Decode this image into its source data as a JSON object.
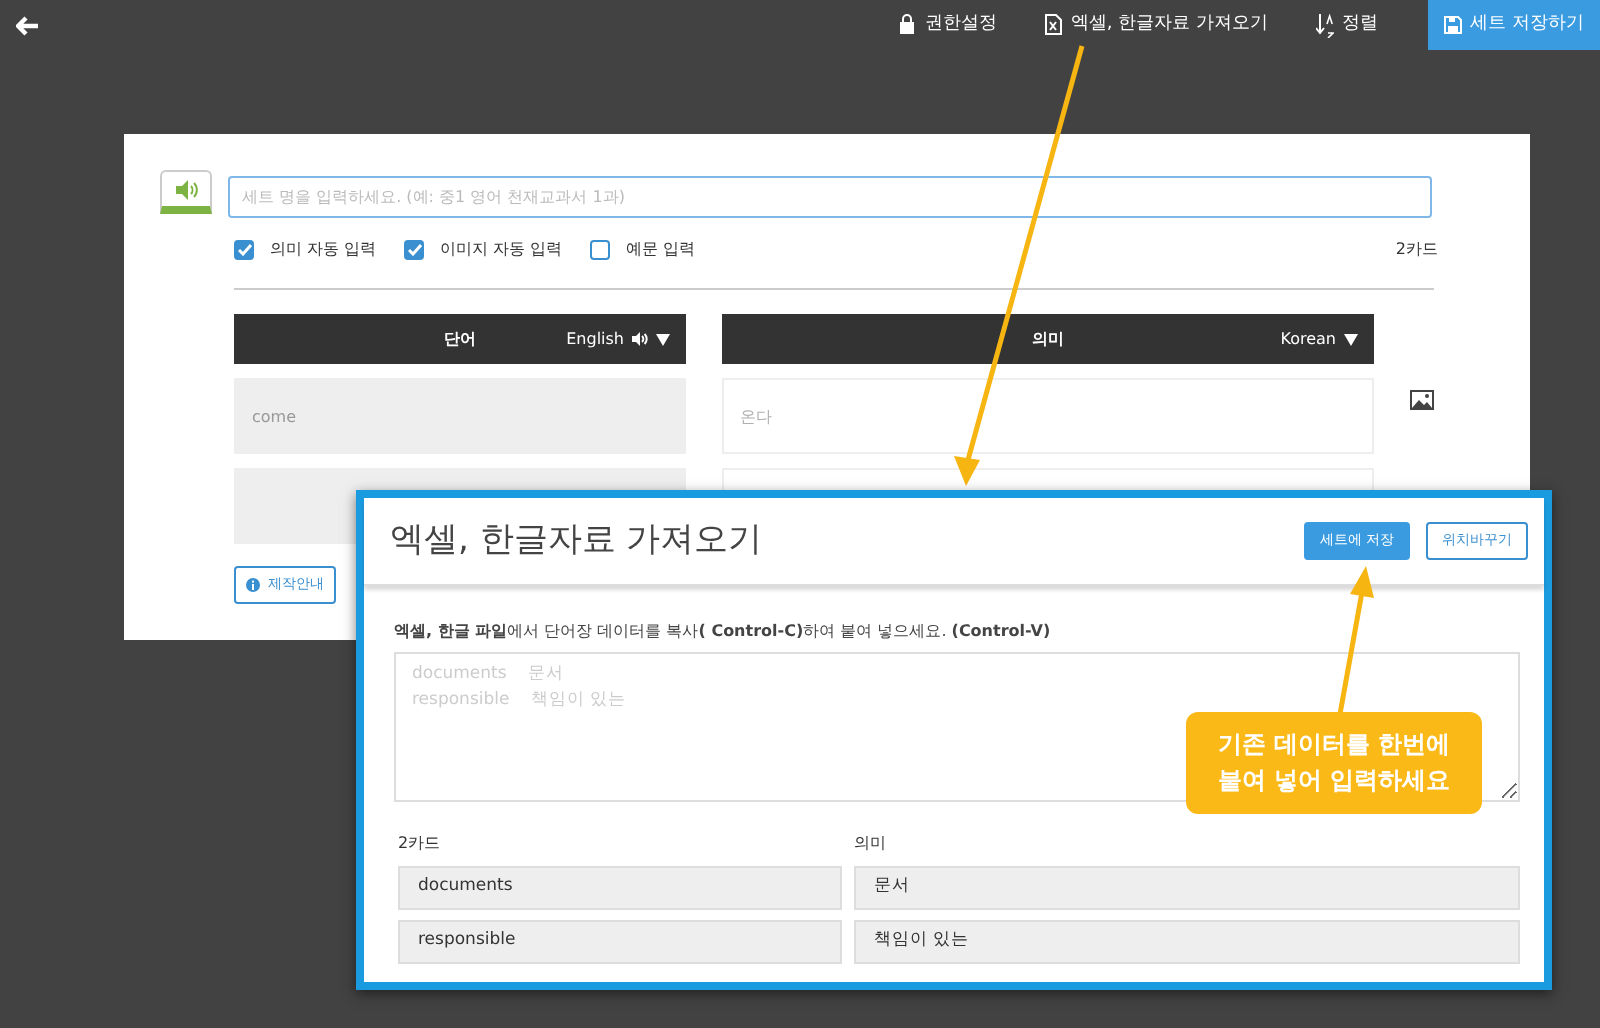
{
  "toolbar": {
    "items": [
      {
        "kind": "lock",
        "label": "권한설정"
      },
      {
        "kind": "file",
        "label": "엑셀, 한글자료 가져오기"
      },
      {
        "kind": "sort",
        "label": "정렬"
      }
    ],
    "save_button": "세트 저장하기"
  },
  "editor": {
    "title_placeholder": "세트 명을 입력하세요. (예: 중1 영어 천재교과서 1과)",
    "options": [
      {
        "label": "의미 자동 입력",
        "checked": true
      },
      {
        "label": "이미지 자동 입력",
        "checked": true
      },
      {
        "label": "예문 입력",
        "checked": false
      }
    ],
    "card_count": "2카드",
    "columns": [
      {
        "label": "단어",
        "language": "English",
        "speaker": true
      },
      {
        "label": "의미",
        "language": "Korean",
        "speaker": false
      }
    ],
    "rows": [
      {
        "word_placeholder": "come",
        "meaning_placeholder": "온다"
      },
      {}
    ],
    "guide_button": "제작안내"
  },
  "import_dialog": {
    "title": "엑셀, 한글자료 가져오기",
    "buttons": [
      {
        "label": "세트에 저장",
        "kind": "primary"
      },
      {
        "label": "위치바꾸기",
        "kind": "outline"
      }
    ],
    "instruction": "**엑셀, 한글 파일**에서 단어장 데이터를 복사**( Control-C)**하여 붙여 넣으세요. **(Control-V)**",
    "paste_placeholder": "documents    문서\nresponsible    책임이 있는",
    "headers": [
      "2카드",
      "의미"
    ],
    "rows": [
      [
        "documents",
        "문서"
      ],
      [
        "responsible",
        "책임이 있는"
      ]
    ]
  },
  "callout": "기존 데이터를 한번에\n붙여 넣어 입력하세요"
}
